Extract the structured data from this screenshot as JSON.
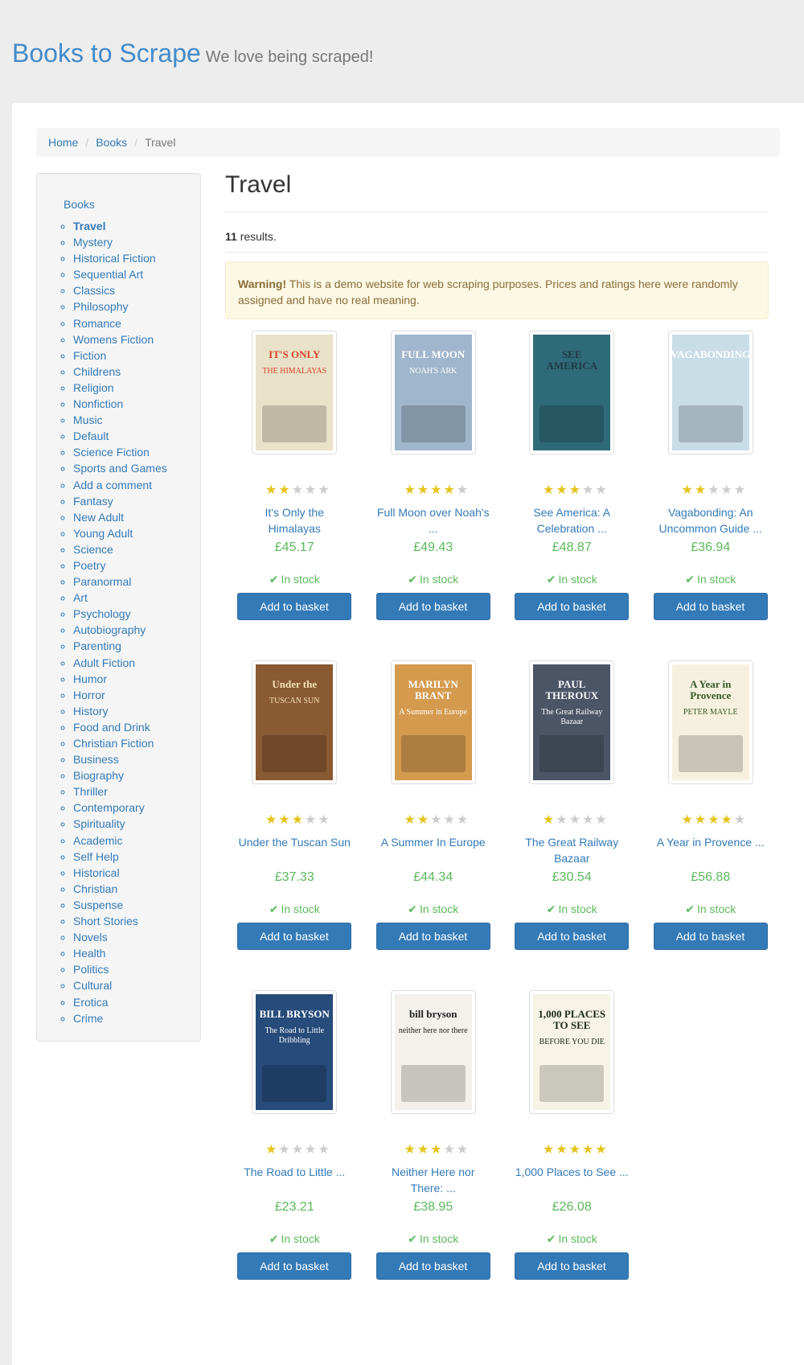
{
  "header": {
    "brand": "Books to Scrape",
    "tagline": "We love being scraped!"
  },
  "breadcrumb": {
    "home": "Home",
    "books": "Books",
    "current": "Travel",
    "separator": "/"
  },
  "sidebar": {
    "heading": "Books",
    "categories": [
      "Travel",
      "Mystery",
      "Historical Fiction",
      "Sequential Art",
      "Classics",
      "Philosophy",
      "Romance",
      "Womens Fiction",
      "Fiction",
      "Childrens",
      "Religion",
      "Nonfiction",
      "Music",
      "Default",
      "Science Fiction",
      "Sports and Games",
      "Add a comment",
      "Fantasy",
      "New Adult",
      "Young Adult",
      "Science",
      "Poetry",
      "Paranormal",
      "Art",
      "Psychology",
      "Autobiography",
      "Parenting",
      "Adult Fiction",
      "Humor",
      "Horror",
      "History",
      "Food and Drink",
      "Christian Fiction",
      "Business",
      "Biography",
      "Thriller",
      "Contemporary",
      "Spirituality",
      "Academic",
      "Self Help",
      "Historical",
      "Christian",
      "Suspense",
      "Short Stories",
      "Novels",
      "Health",
      "Politics",
      "Cultural",
      "Erotica",
      "Crime"
    ],
    "selected_index": 0
  },
  "main": {
    "title": "Travel",
    "results_count": "11",
    "results_suffix": " results.",
    "warning_label": "Warning!",
    "warning_text": " This is a demo website for web scraping purposes. Prices and ratings here were randomly assigned and have no real meaning."
  },
  "colors": {
    "brand": "#428bca",
    "link": "#337ab7",
    "price": "#5cb85c",
    "star_on": "#e6c31a",
    "star_off": "#cccccc",
    "button": "#337ab7"
  },
  "products": [
    {
      "title_line1": "It's Only the",
      "title_line2": "Himalayas",
      "price": "£45.17",
      "rating": 2,
      "stock": "In stock",
      "button": "Add to basket",
      "cover": {
        "text1": "IT'S ONLY",
        "text2": "THE HIMALAYAS",
        "bg": "#e9e2c9",
        "ink": "#d6422a"
      }
    },
    {
      "title_line1": "Full Moon over Noah's",
      "title_line2": "...",
      "price": "£49.43",
      "rating": 4,
      "stock": "In stock",
      "button": "Add to basket",
      "cover": {
        "text1": "FULL MOON",
        "text2": "NOAH'S ARK",
        "bg": "#9fb6cc",
        "ink": "#ffffff"
      }
    },
    {
      "title_line1": "See America: A",
      "title_line2": "Celebration ...",
      "price": "£48.87",
      "rating": 3,
      "stock": "In stock",
      "button": "Add to basket",
      "cover": {
        "text1": "SEE AMERICA",
        "text2": "",
        "bg": "#2f6a78",
        "ink": "#1f3b46"
      }
    },
    {
      "title_line1": "Vagabonding: An",
      "title_line2": "Uncommon Guide ...",
      "price": "£36.94",
      "rating": 2,
      "stock": "In stock",
      "button": "Add to basket",
      "cover": {
        "text1": "VAGABONDING",
        "text2": "",
        "bg": "#c9dde7",
        "ink": "#ffffff"
      }
    },
    {
      "title_line1": "Under the Tuscan Sun",
      "title_line2": "",
      "price": "£37.33",
      "rating": 3,
      "stock": "In stock",
      "button": "Add to basket",
      "cover": {
        "text1": "Under the",
        "text2": "TUSCAN SUN",
        "bg": "#8a5a33",
        "ink": "#f3e2b3"
      }
    },
    {
      "title_line1": "A Summer In Europe",
      "title_line2": "",
      "price": "£44.34",
      "rating": 2,
      "stock": "In stock",
      "button": "Add to basket",
      "cover": {
        "text1": "MARILYN BRANT",
        "text2": "A Summer in Europe",
        "bg": "#d49a4e",
        "ink": "#ffffff"
      }
    },
    {
      "title_line1": "The Great Railway",
      "title_line2": "Bazaar",
      "price": "£30.54",
      "rating": 1,
      "stock": "In stock",
      "button": "Add to basket",
      "cover": {
        "text1": "PAUL THEROUX",
        "text2": "The Great Railway Bazaar",
        "bg": "#4b5566",
        "ink": "#ffffff"
      }
    },
    {
      "title_line1": "A Year in Provence ...",
      "title_line2": "",
      "price": "£56.88",
      "rating": 4,
      "stock": "In stock",
      "button": "Add to basket",
      "cover": {
        "text1": "A Year in Provence",
        "text2": "PETER MAYLE",
        "bg": "#f6f1df",
        "ink": "#3a5a2a"
      }
    },
    {
      "title_line1": "The Road to Little ...",
      "title_line2": "",
      "price": "£23.21",
      "rating": 1,
      "stock": "In stock",
      "button": "Add to basket",
      "cover": {
        "text1": "BILL BRYSON",
        "text2": "The Road to Little Dribbling",
        "bg": "#274b7a",
        "ink": "#ffffff"
      }
    },
    {
      "title_line1": "Neither Here nor",
      "title_line2": "There: ...",
      "price": "£38.95",
      "rating": 3,
      "stock": "In stock",
      "button": "Add to basket",
      "cover": {
        "text1": "bill bryson",
        "text2": "neither here nor there",
        "bg": "#f4f1ec",
        "ink": "#222222"
      }
    },
    {
      "title_line1": "1,000 Places to See ...",
      "title_line2": "",
      "price": "£26.08",
      "rating": 5,
      "stock": "In stock",
      "button": "Add to basket",
      "cover": {
        "text1": "1,000 PLACES TO SEE",
        "text2": "BEFORE YOU DIE",
        "bg": "#f7f3e6",
        "ink": "#1d2a1d"
      }
    }
  ]
}
